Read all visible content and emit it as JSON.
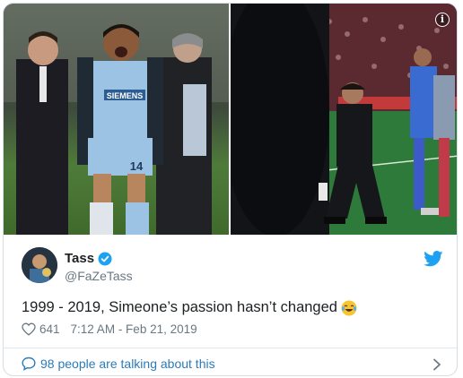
{
  "tweet": {
    "display_name": "Tass",
    "handle": "@FaZeTass",
    "text": "1999 - 2019, Simeone’s passion hasn’t changed",
    "emoji": "face-with-tears-of-joy",
    "likes": "641",
    "timestamp": "7:12 AM - Feb 21, 2019",
    "talking_label": "98 people are talking about this",
    "verified": true
  },
  "media": {
    "left_photo": {
      "jersey_sponsor": "SIEMENS",
      "jersey_number": "14"
    },
    "info_label": "i"
  },
  "colors": {
    "link_blue": "#2b7bb9",
    "twitter_blue": "#1da1f2",
    "muted_gray": "#697882",
    "lazio_sky": "#9cc3e4"
  }
}
